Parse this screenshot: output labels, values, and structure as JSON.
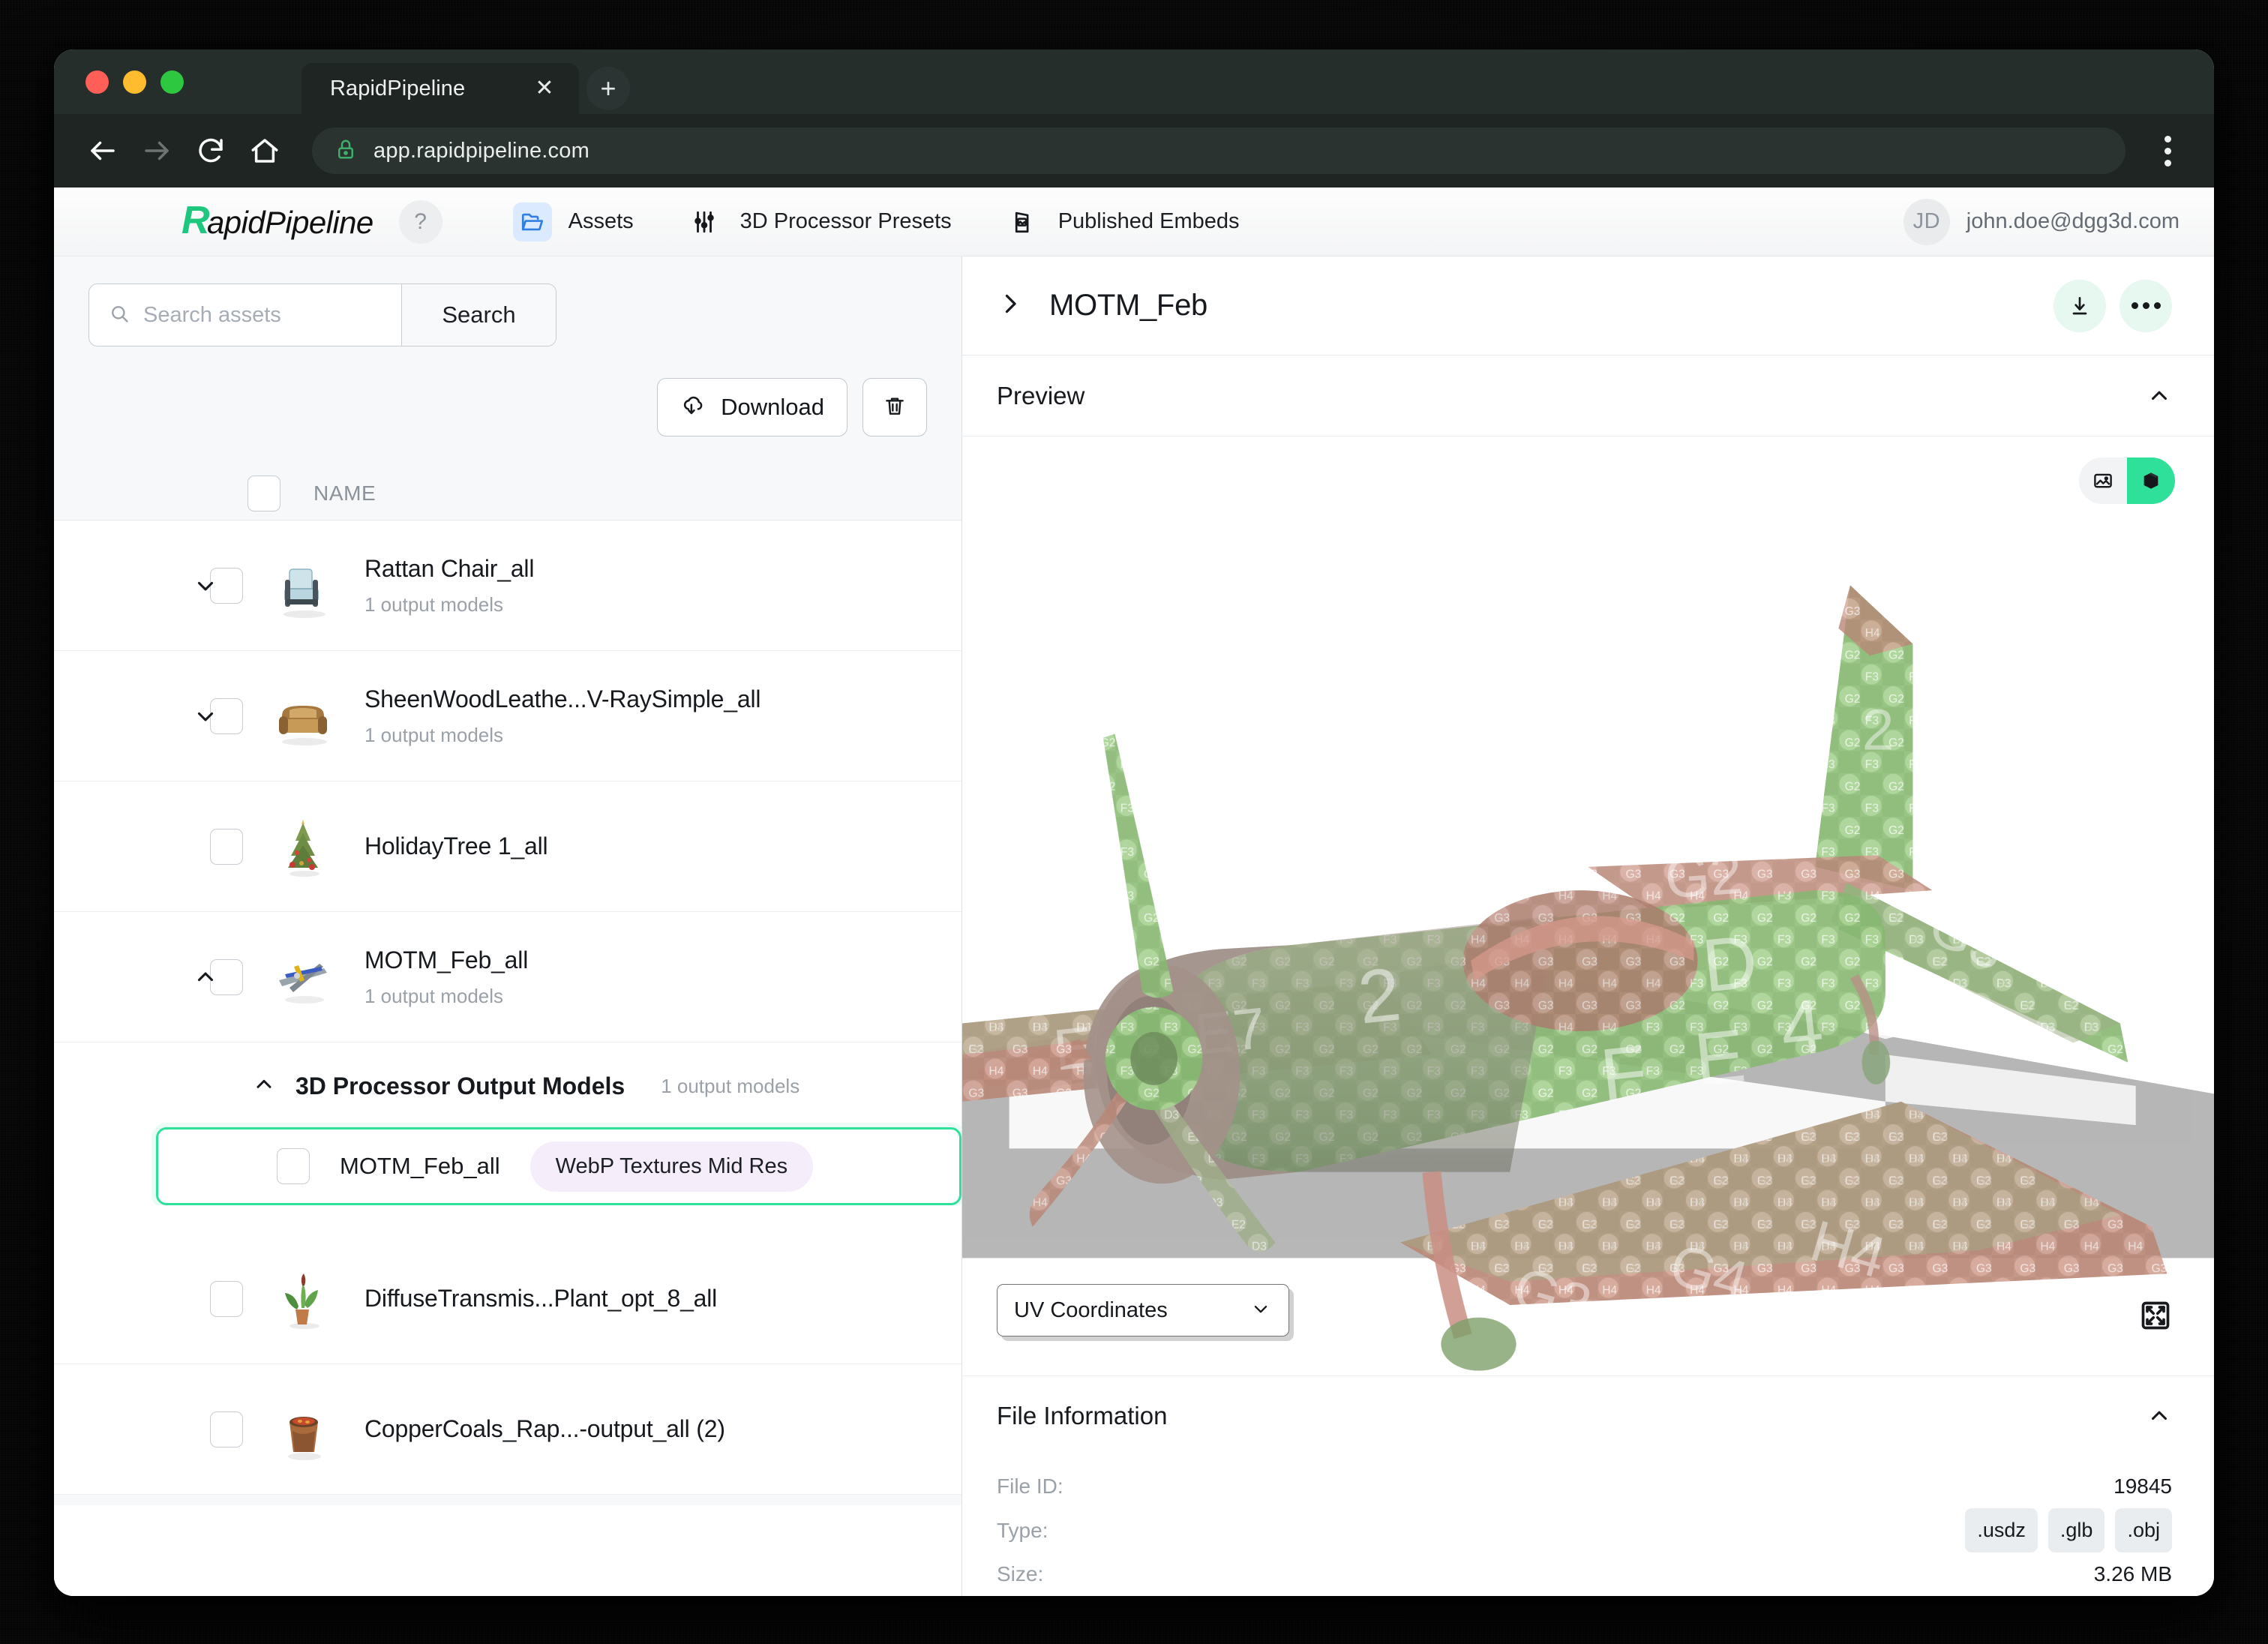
{
  "browser": {
    "tab_title": "RapidPipeline",
    "close_label": "✕",
    "newtab_label": "+",
    "url": "app.rapidpipeline.com"
  },
  "appheader": {
    "brand_initial": "R",
    "brand_rest": "apidPipeline",
    "help_label": "?",
    "nav": [
      {
        "label": "Assets",
        "icon": "folder-open-icon",
        "active": true
      },
      {
        "label": "3D Processor Presets",
        "icon": "sliders-icon",
        "active": false
      },
      {
        "label": "Published Embeds",
        "icon": "embed-image-icon",
        "active": false
      }
    ],
    "user": {
      "initials": "JD",
      "email": "john.doe@dgg3d.com"
    }
  },
  "left": {
    "search": {
      "placeholder": "Search assets",
      "value": "",
      "button_label": "Search"
    },
    "toolbar": {
      "download_label": "Download"
    },
    "column_header": "NAME",
    "rows": [
      {
        "name": "Rattan Chair_all",
        "sub": "1 output models",
        "expandable": true,
        "expanded": false,
        "thumb": "chair-thumb"
      },
      {
        "name": "SheenWoodLeathe...V-RaySimple_all",
        "sub": "1 output models",
        "expandable": true,
        "expanded": false,
        "thumb": "sofa-thumb"
      },
      {
        "name": "HolidayTree 1_all",
        "sub": "",
        "expandable": false,
        "expanded": false,
        "thumb": "tree-thumb"
      },
      {
        "name": "MOTM_Feb_all",
        "sub": "1 output models",
        "expandable": true,
        "expanded": true,
        "thumb": "plane-thumb"
      }
    ],
    "group": {
      "title": "3D Processor Output Models",
      "sub": "1 output models"
    },
    "child": {
      "name": "MOTM_Feb_all",
      "badge": "WebP Textures Mid Res"
    },
    "rows_after": [
      {
        "name": "DiffuseTransmis...Plant_opt_8_all",
        "sub": "",
        "expandable": false,
        "thumb": "plant-thumb"
      },
      {
        "name": "CopperCoals_Rap...-output_all (2)",
        "sub": "",
        "expandable": false,
        "thumb": "pot-thumb"
      }
    ]
  },
  "right": {
    "title": "MOTM_Feb",
    "preview": {
      "title": "Preview"
    },
    "viewer": {
      "toggle_image_icon": "image-icon",
      "toggle_3d_icon": "cube-icon",
      "uv_select_value": "UV Coordinates",
      "uv_options": [
        "UV Coordinates"
      ],
      "fullscreen_icon": "fullscreen-icon"
    },
    "file_information": {
      "title": "File Information",
      "rows": [
        {
          "key": "File ID:",
          "value": "19845",
          "chips": []
        },
        {
          "key": "Type:",
          "value": "",
          "chips": [
            ".usdz",
            ".glb",
            ".obj"
          ]
        },
        {
          "key": "Size:",
          "value": "3.26 MB",
          "chips": []
        }
      ]
    }
  },
  "colors": {
    "accent_green": "#2ee09a",
    "badge_purple": "#f6edfa",
    "nav_active_blue": "#dbeafe"
  }
}
